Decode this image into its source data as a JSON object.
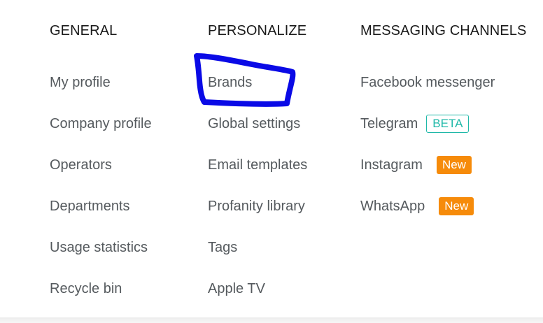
{
  "general": {
    "heading": "GENERAL",
    "items": [
      {
        "label": "My profile"
      },
      {
        "label": "Company profile"
      },
      {
        "label": "Operators"
      },
      {
        "label": "Departments"
      },
      {
        "label": "Usage statistics"
      },
      {
        "label": "Recycle bin"
      }
    ]
  },
  "personalize": {
    "heading": "PERSONALIZE",
    "items": [
      {
        "label": "Brands"
      },
      {
        "label": "Global settings"
      },
      {
        "label": "Email templates"
      },
      {
        "label": "Profanity library"
      },
      {
        "label": "Tags"
      },
      {
        "label": "Apple TV"
      }
    ]
  },
  "messaging": {
    "heading": "MESSAGING CHANNELS",
    "items": [
      {
        "label": "Facebook messenger"
      },
      {
        "label": "Telegram",
        "badge": "BETA"
      },
      {
        "label": "Instagram",
        "badge": "New"
      },
      {
        "label": "WhatsApp",
        "badge": "New"
      }
    ]
  },
  "colors": {
    "heading": "#1a1a1a",
    "item": "#555a5e",
    "beta_badge": "#1fb8a8",
    "new_badge": "#f68b0a",
    "highlight_scribble": "#0a0ae6"
  }
}
